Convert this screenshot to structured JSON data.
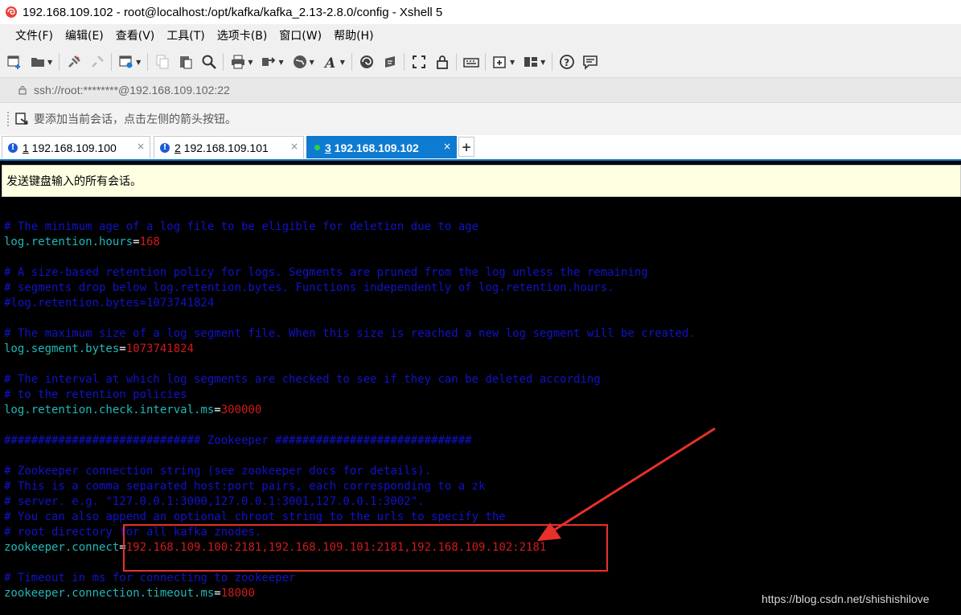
{
  "window": {
    "title": "192.168.109.102 - root@localhost:/opt/kafka/kafka_2.13-2.8.0/config - Xshell 5"
  },
  "menu": {
    "items": [
      "文件(F)",
      "编辑(E)",
      "查看(V)",
      "工具(T)",
      "选项卡(B)",
      "窗口(W)",
      "帮助(H)"
    ]
  },
  "toolbar": {
    "icons": [
      "new-session-icon",
      "open-folder-icon",
      "connect-icon",
      "disconnect-icon",
      "properties-icon",
      "copy-icon",
      "paste-icon",
      "find-icon",
      "print-icon",
      "transfer-icon",
      "globe-icon",
      "font-icon",
      "xftp-icon",
      "script-icon",
      "fullscreen-icon",
      "lock-icon",
      "keyboard-icon",
      "new-tab-icon",
      "layout-icon",
      "help-icon",
      "chat-icon"
    ]
  },
  "address": {
    "text": "ssh://root:********@192.168.109.102:22"
  },
  "hint": {
    "text": "要添加当前会话，点击左侧的箭头按钮。"
  },
  "tabs": [
    {
      "num": "1",
      "label": " 192.168.109.100",
      "status": "warning",
      "active": false
    },
    {
      "num": "2",
      "label": " 192.168.109.101",
      "status": "warning",
      "active": false
    },
    {
      "num": "3",
      "label": " 192.168.109.102",
      "status": "connected",
      "active": true
    }
  ],
  "compose": {
    "text": "发送键盘输入的所有会话。"
  },
  "terminal": {
    "lines": [
      {
        "comment": "# The minimum age of a log file to be eligible for deletion due to age"
      },
      {
        "key": "log.retention.hours",
        "value": "168"
      },
      {
        "comment": "# A size-based retention policy for logs. Segments are pruned from the log unless the remaining"
      },
      {
        "comment": "# segments drop below log.retention.bytes. Functions independently of log.retention.hours."
      },
      {
        "comment": "#log.retention.bytes=1073741824"
      },
      {
        "comment": "# The maximum size of a log segment file. When this size is reached a new log segment will be created."
      },
      {
        "key": "log.segment.bytes",
        "value": "1073741824"
      },
      {
        "comment": "# The interval at which log segments are checked to see if they can be deleted according"
      },
      {
        "comment": "# to the retention policies"
      },
      {
        "key": "log.retention.check.interval.ms",
        "value": "300000"
      },
      {
        "comment": "############################# Zookeeper #############################"
      },
      {
        "comment": "# Zookeeper connection string (see zookeeper docs for details)."
      },
      {
        "comment": "# This is a comma separated host:port pairs, each corresponding to a zk"
      },
      {
        "comment": "# server. e.g. \"127.0.0.1:3000,127.0.0.1:3001,127.0.0.1:3002\"."
      },
      {
        "comment": "# You can also append an optional chroot string to the urls to specify the"
      },
      {
        "comment": "# root directory for all kafka znodes."
      },
      {
        "key": "zookeeper.connect",
        "value": "192.168.109.100:2181,192.168.109.101:2181,192.168.109.102:2181"
      },
      {
        "comment": "# Timeout in ms for connecting to zookeeper"
      },
      {
        "key": "zookeeper.connection.timeout.ms",
        "value": "18000"
      }
    ]
  },
  "watermark": {
    "text": "https://blog.csdn.net/shishishilove"
  },
  "colors": {
    "comment": "#1212c8",
    "key": "#1fb8b8",
    "value": "#d11a1a",
    "annotation": "#e8302a",
    "active_tab": "#0e7bd1"
  }
}
